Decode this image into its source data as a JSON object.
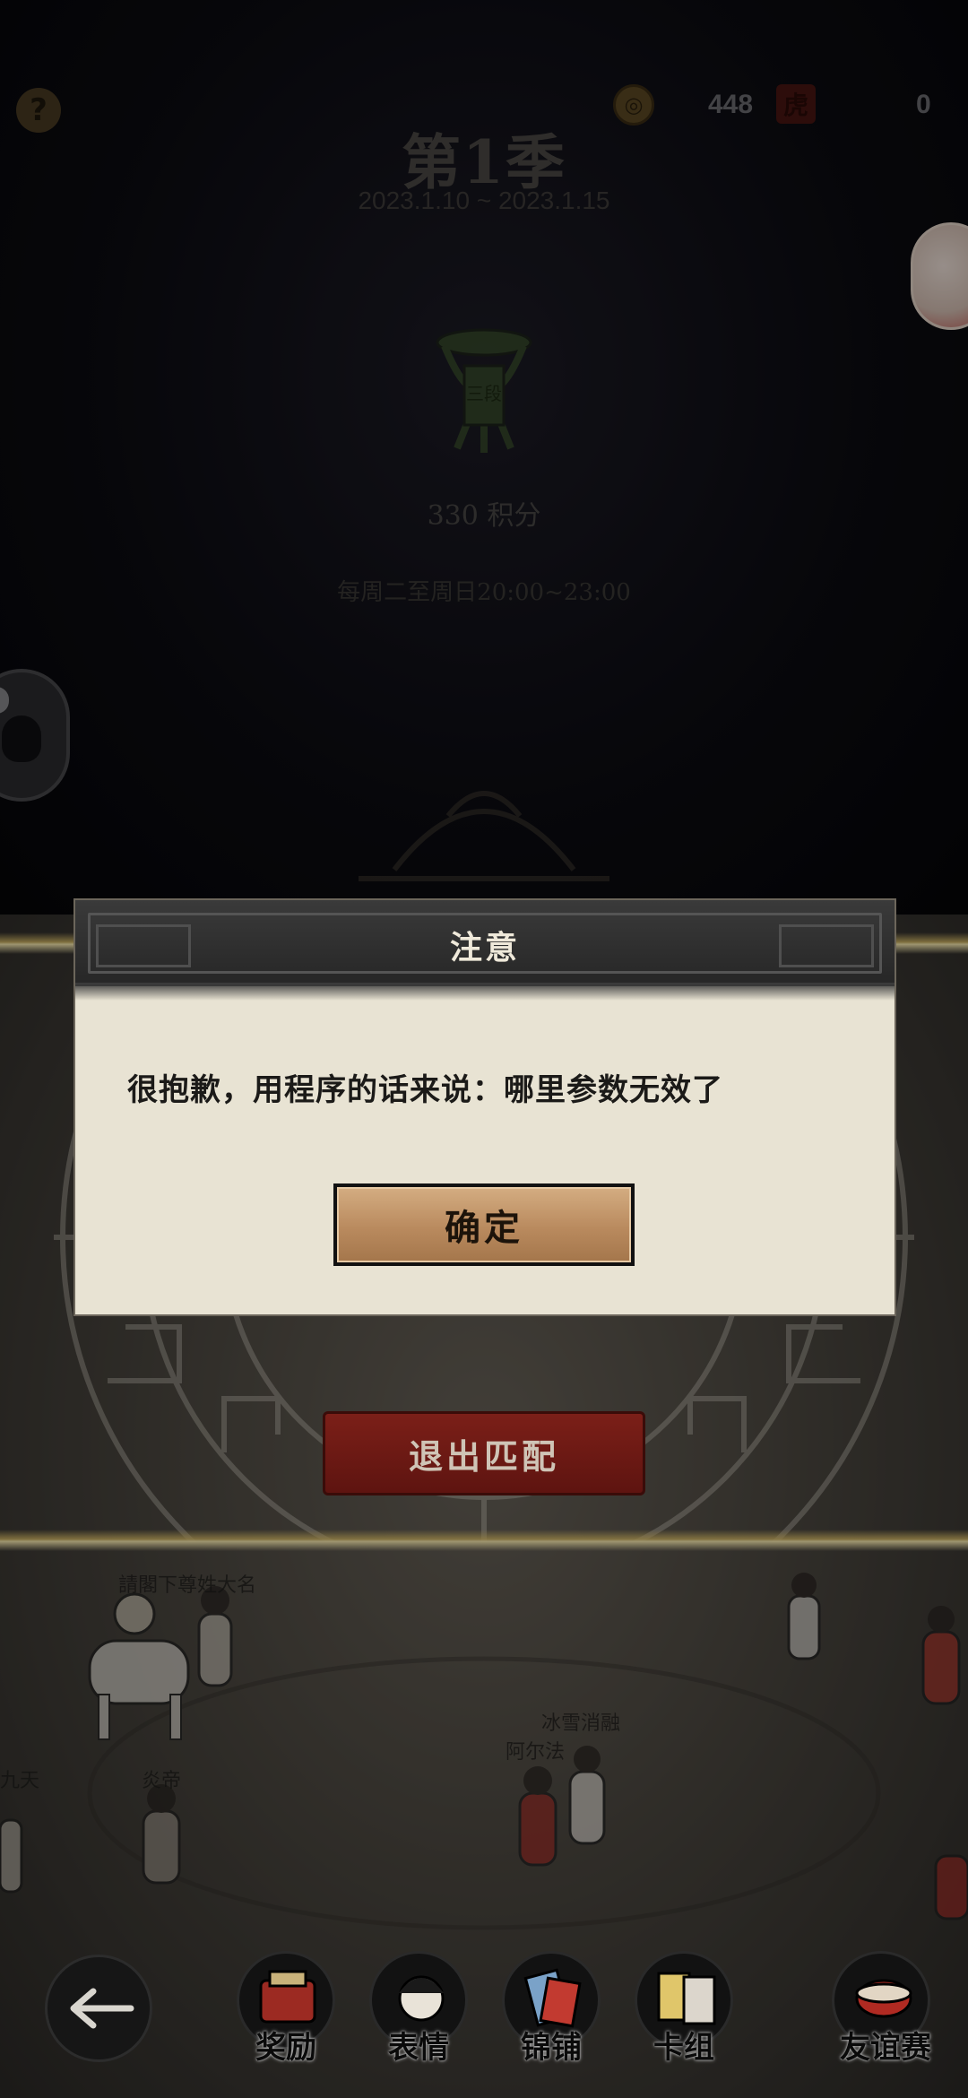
{
  "topbar": {
    "help_icon": "?",
    "currency_amount": "448",
    "ticket_glyph": "虎",
    "other_amount": "0"
  },
  "season": {
    "title": "第1季",
    "dates": "2023.1.10 ~ 2023.1.15",
    "rank_badge": "三段",
    "score": "330 积分",
    "schedule": "每周二至周日20:00~23:00"
  },
  "dialog": {
    "title": "注意",
    "message": "很抱歉，用程序的话来说：哪里参数无效了",
    "confirm_label": "确定"
  },
  "match": {
    "exit_label": "退出匹配"
  },
  "players": [
    {
      "name": "請閣下尊姓大名"
    },
    {
      "name": "冰雪消融"
    },
    {
      "name": "阿尔法"
    },
    {
      "name": "九天"
    },
    {
      "name": "炎帝"
    }
  ],
  "bottom_nav": {
    "items": [
      {
        "label": "奖励",
        "icon": "reward-icon"
      },
      {
        "label": "表情",
        "icon": "emote-icon"
      },
      {
        "label": "锦铺",
        "icon": "shop-icon"
      },
      {
        "label": "卡组",
        "icon": "deck-icon"
      },
      {
        "label": "友谊赛",
        "icon": "friendly-match-icon"
      }
    ]
  },
  "colors": {
    "dialog_bg": "#e8e3d3",
    "confirm_button": "#c19366",
    "exit_button": "#6e1a14",
    "gold_line": "#e6c86e"
  }
}
